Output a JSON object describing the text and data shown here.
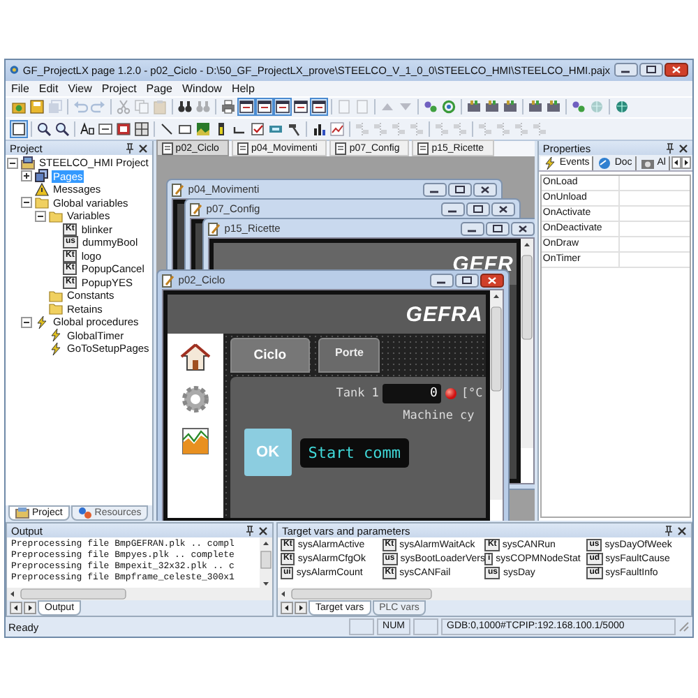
{
  "window": {
    "title": "GF_ProjectLX page 1.2.0 - p02_Ciclo - D:\\50_GF_ProjectLX_prove\\STEELCO_V_1_0_0\\STEELCO_HMI\\STEELCO_HMI.pajx"
  },
  "menu": [
    "File",
    "Edit",
    "View",
    "Project",
    "Page",
    "Window",
    "Help"
  ],
  "toolbar_rows": [
    [
      {
        "kind": "open",
        "pressed": false,
        "disabled": false
      },
      {
        "kind": "save",
        "pressed": false,
        "disabled": false
      },
      {
        "kind": "saveall",
        "pressed": false,
        "disabled": true
      },
      {
        "kind": "sep"
      },
      {
        "kind": "undo",
        "pressed": false,
        "disabled": true
      },
      {
        "kind": "redo",
        "pressed": false,
        "disabled": true
      },
      {
        "kind": "sep"
      },
      {
        "kind": "cut",
        "pressed": false,
        "disabled": true
      },
      {
        "kind": "copy",
        "pressed": false,
        "disabled": true
      },
      {
        "kind": "paste",
        "pressed": false,
        "disabled": true
      },
      {
        "kind": "sep"
      },
      {
        "kind": "find",
        "pressed": false,
        "disabled": false
      },
      {
        "kind": "find",
        "pressed": false,
        "disabled": true
      },
      {
        "kind": "sep"
      },
      {
        "kind": "print",
        "pressed": false,
        "disabled": false
      },
      {
        "kind": "window",
        "pressed": true,
        "disabled": false
      },
      {
        "kind": "window",
        "pressed": true,
        "disabled": false
      },
      {
        "kind": "window",
        "pressed": true,
        "disabled": false
      },
      {
        "kind": "window",
        "pressed": false,
        "disabled": false
      },
      {
        "kind": "window",
        "pressed": true,
        "disabled": false
      },
      {
        "kind": "sep"
      },
      {
        "kind": "page",
        "pressed": false,
        "disabled": true
      },
      {
        "kind": "page",
        "pressed": false,
        "disabled": true
      },
      {
        "kind": "sep"
      },
      {
        "kind": "up",
        "pressed": false,
        "disabled": true
      },
      {
        "kind": "down",
        "pressed": false,
        "disabled": true
      },
      {
        "kind": "sep"
      },
      {
        "kind": "link",
        "pressed": false,
        "disabled": false
      },
      {
        "kind": "refresh",
        "pressed": false,
        "disabled": false
      },
      {
        "kind": "sep"
      },
      {
        "kind": "tool",
        "pressed": false,
        "disabled": false
      },
      {
        "kind": "tool",
        "pressed": false,
        "disabled": false
      },
      {
        "kind": "tool",
        "pressed": false,
        "disabled": false
      },
      {
        "kind": "sep"
      },
      {
        "kind": "tool",
        "pressed": false,
        "disabled": false
      },
      {
        "kind": "tool",
        "pressed": false,
        "disabled": false
      },
      {
        "kind": "sep"
      },
      {
        "kind": "link",
        "pressed": false,
        "disabled": false
      },
      {
        "kind": "globe",
        "pressed": false,
        "disabled": true
      },
      {
        "kind": "sep"
      },
      {
        "kind": "globe",
        "pressed": false,
        "disabled": false
      }
    ],
    [
      {
        "kind": "select",
        "pressed": true,
        "disabled": false
      },
      {
        "kind": "sep"
      },
      {
        "kind": "zoomin",
        "pressed": false,
        "disabled": false
      },
      {
        "kind": "zoomin",
        "pressed": false,
        "disabled": false
      },
      {
        "kind": "sep"
      },
      {
        "kind": "text",
        "pressed": false,
        "disabled": false
      },
      {
        "kind": "field",
        "pressed": false,
        "disabled": false
      },
      {
        "kind": "button",
        "pressed": false,
        "disabled": false
      },
      {
        "kind": "grid",
        "pressed": false,
        "disabled": false
      },
      {
        "kind": "sep"
      },
      {
        "kind": "line",
        "pressed": false,
        "disabled": false
      },
      {
        "kind": "rect",
        "pressed": false,
        "disabled": false
      },
      {
        "kind": "picture",
        "pressed": false,
        "disabled": false
      },
      {
        "kind": "bar",
        "pressed": false,
        "disabled": false
      },
      {
        "kind": "bracket",
        "pressed": false,
        "disabled": false
      },
      {
        "kind": "check",
        "pressed": false,
        "disabled": false
      },
      {
        "kind": "display",
        "pressed": false,
        "disabled": false
      },
      {
        "kind": "hammer",
        "pressed": false,
        "disabled": false
      },
      {
        "kind": "sep"
      },
      {
        "kind": "chart",
        "pressed": false,
        "disabled": false
      },
      {
        "kind": "trend",
        "pressed": false,
        "disabled": false
      },
      {
        "kind": "sep"
      },
      {
        "kind": "align",
        "pressed": false,
        "disabled": true
      },
      {
        "kind": "align",
        "pressed": false,
        "disabled": true
      },
      {
        "kind": "align",
        "pressed": false,
        "disabled": true
      },
      {
        "kind": "align",
        "pressed": false,
        "disabled": true
      },
      {
        "kind": "sep"
      },
      {
        "kind": "align",
        "pressed": false,
        "disabled": true
      },
      {
        "kind": "align",
        "pressed": false,
        "disabled": true
      },
      {
        "kind": "sep"
      },
      {
        "kind": "align",
        "pressed": false,
        "disabled": true
      },
      {
        "kind": "align",
        "pressed": false,
        "disabled": true
      },
      {
        "kind": "align",
        "pressed": false,
        "disabled": true
      },
      {
        "kind": "align",
        "pressed": false,
        "disabled": true
      }
    ]
  ],
  "project_panel": {
    "title": "Project",
    "tree": [
      {
        "label": "STEELCO_HMI Project",
        "kind": "project",
        "selected": false,
        "expanded": true,
        "children": [
          {
            "label": "Pages",
            "kind": "pages",
            "selected": true,
            "expanded": false
          },
          {
            "label": "Messages",
            "kind": "messages",
            "selected": false
          },
          {
            "label": "Global variables",
            "kind": "folder",
            "selected": false,
            "expanded": true,
            "children": [
              {
                "label": "Variables",
                "kind": "folder",
                "selected": false,
                "expanded": true,
                "children": [
                  {
                    "label": "blinker",
                    "kind": "var",
                    "type": "Kt",
                    "selected": false
                  },
                  {
                    "label": "dummyBool",
                    "kind": "var",
                    "type": "us",
                    "selected": false
                  },
                  {
                    "label": "logo",
                    "kind": "var",
                    "type": "Kt",
                    "selected": false
                  },
                  {
                    "label": "PopupCancel",
                    "kind": "var",
                    "type": "Kt",
                    "selected": false
                  },
                  {
                    "label": "PopupYES",
                    "kind": "var",
                    "type": "Kt",
                    "selected": false
                  }
                ]
              },
              {
                "label": "Constants",
                "kind": "folder",
                "selected": false
              },
              {
                "label": "Retains",
                "kind": "folder",
                "selected": false
              }
            ]
          },
          {
            "label": "Global procedures",
            "kind": "procedure",
            "selected": false,
            "expanded": true,
            "children": [
              {
                "label": "GlobalTimer",
                "kind": "procedure",
                "selected": false
              },
              {
                "label": "GoToSetupPages",
                "kind": "procedure",
                "selected": false
              }
            ]
          }
        ]
      }
    ],
    "tabs": [
      {
        "label": "Project",
        "kind": "project",
        "selected": true
      },
      {
        "label": "Resources",
        "kind": "resources",
        "selected": false
      }
    ]
  },
  "page_tabs": [
    {
      "label": "p02_Ciclo",
      "selected": true
    },
    {
      "label": "p04_Movimenti",
      "selected": false
    },
    {
      "label": "p07_Config",
      "selected": false
    },
    {
      "label": "p15_Ricette",
      "selected": false
    }
  ],
  "page_windows": [
    {
      "title": "p04_Movimenti",
      "active": false
    },
    {
      "title": "p07_Config",
      "active": false
    },
    {
      "title": "p15_Ricette",
      "active": false,
      "logo": "GEFR"
    },
    {
      "title": "p02_Ciclo",
      "active": true,
      "hmi": {
        "logo": "GEFRA",
        "tabs": [
          {
            "label": "Ciclo",
            "selected": true
          },
          {
            "label": "Porte",
            "selected": false
          }
        ],
        "tank_label": "Tank 1",
        "tank_value": "0",
        "alarm_on": true,
        "unit": "[°C",
        "cycle_label": "Machine cy",
        "ok_button": "OK",
        "message": "Start comm"
      }
    }
  ],
  "properties": {
    "title": "Properties",
    "tabs": [
      {
        "label": "Events",
        "kind": "events",
        "selected": true
      },
      {
        "label": "Doc",
        "kind": "doc",
        "selected": false
      },
      {
        "label": "Al",
        "kind": "alarms",
        "selected": false
      }
    ],
    "events": [
      "OnLoad",
      "OnUnload",
      "OnActivate",
      "OnDeactivate",
      "OnDraw",
      "OnTimer"
    ]
  },
  "output": {
    "title": "Output",
    "lines": [
      "Preprocessing file BmpGEFRAN.plk .. compl",
      "Preprocessing file Bmpyes.plk .. complete",
      "Preprocessing file Bmpexit_32x32.plk .. c",
      "Preprocessing file Bmpframe_celeste_300x1"
    ],
    "tabs": [
      {
        "label": "Output",
        "selected": true
      }
    ]
  },
  "target_vars": {
    "title": "Target vars and parameters",
    "vars": [
      {
        "type": "Kt",
        "name": "sysAlarmActive"
      },
      {
        "type": "Kt",
        "name": "sysAlarmWaitAck"
      },
      {
        "type": "Kt",
        "name": "sysCANRun"
      },
      {
        "type": "us",
        "name": "sysDayOfWeek"
      },
      {
        "type": "Kt",
        "name": "sysAlarmCfgOk"
      },
      {
        "type": "us",
        "name": "sysBootLoaderVers"
      },
      {
        "type": "i",
        "name": "sysCOPMNodeStat"
      },
      {
        "type": "ud",
        "name": "sysFaultCause"
      },
      {
        "type": "ui",
        "name": "sysAlarmCount"
      },
      {
        "type": "Kt",
        "name": "sysCANFail"
      },
      {
        "type": "us",
        "name": "sysDay"
      },
      {
        "type": "ud",
        "name": "sysFaultInfo"
      }
    ],
    "tabs": [
      {
        "label": "Target vars",
        "selected": true
      },
      {
        "label": "PLC vars",
        "selected": false
      }
    ]
  },
  "status_bar": {
    "message": "Ready",
    "indicator": "NUM",
    "connection": "GDB:0,1000#TCPIP:192.168.100.1/5000"
  }
}
